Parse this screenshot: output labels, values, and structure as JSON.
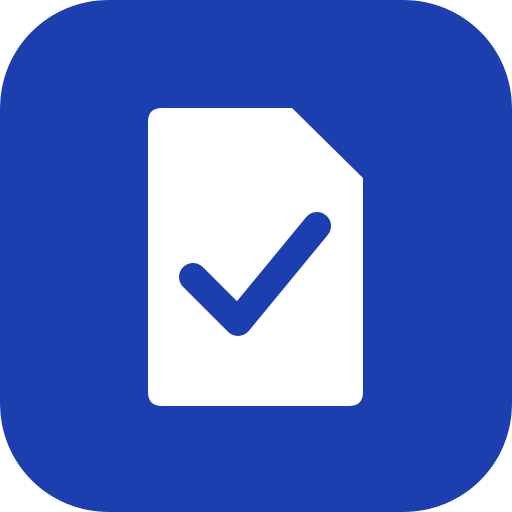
{
  "icon": {
    "name": "document-check-icon",
    "background_color": "#1c3fb0",
    "document_color": "#ffffff",
    "check_color": "#1c3fb0"
  }
}
